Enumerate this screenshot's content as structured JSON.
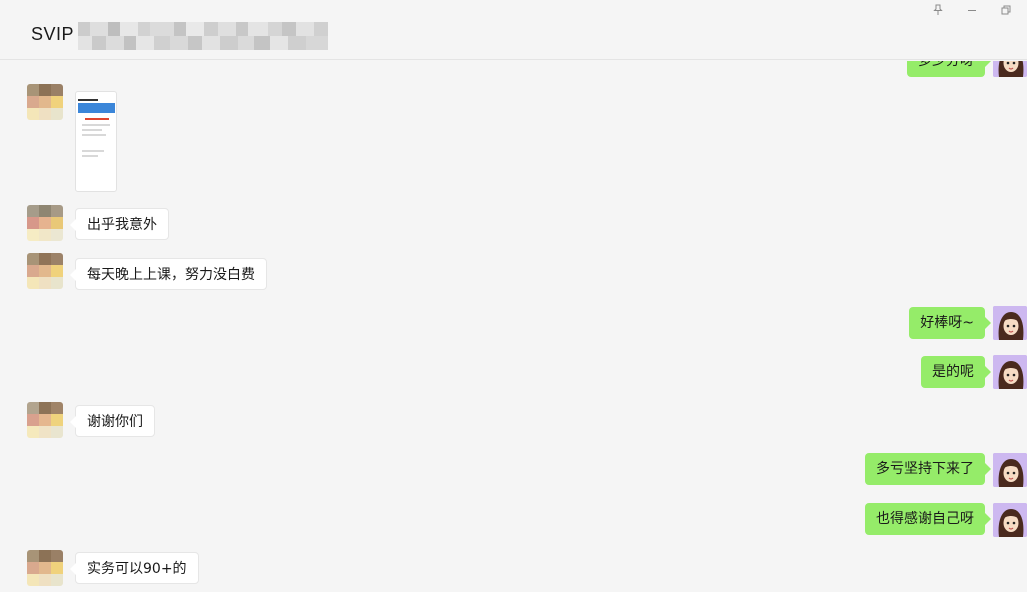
{
  "window": {
    "title": "SVIP",
    "controls": {
      "pin_icon": "pin-icon",
      "minimize_icon": "minimize-icon",
      "restore_icon": "restore-icon"
    }
  },
  "colors": {
    "background": "#f5f5f5",
    "sent_bubble": "#95ec69",
    "received_bubble": "#ffffff"
  },
  "messages": [
    {
      "side": "right",
      "type": "text",
      "text": "多少分呀"
    },
    {
      "side": "left",
      "type": "image",
      "text": ""
    },
    {
      "side": "left",
      "type": "text",
      "text": "出乎我意外"
    },
    {
      "side": "left",
      "type": "text",
      "text": "每天晚上上课，努力没白费"
    },
    {
      "side": "right",
      "type": "text",
      "text": "好棒呀~"
    },
    {
      "side": "right",
      "type": "text",
      "text": "是的呢"
    },
    {
      "side": "left",
      "type": "text",
      "text": "谢谢你们"
    },
    {
      "side": "right",
      "type": "text",
      "text": "多亏坚持下来了"
    },
    {
      "side": "right",
      "type": "text",
      "text": "也得感谢自己呀"
    },
    {
      "side": "left",
      "type": "text",
      "text": "实务可以90+的"
    }
  ]
}
